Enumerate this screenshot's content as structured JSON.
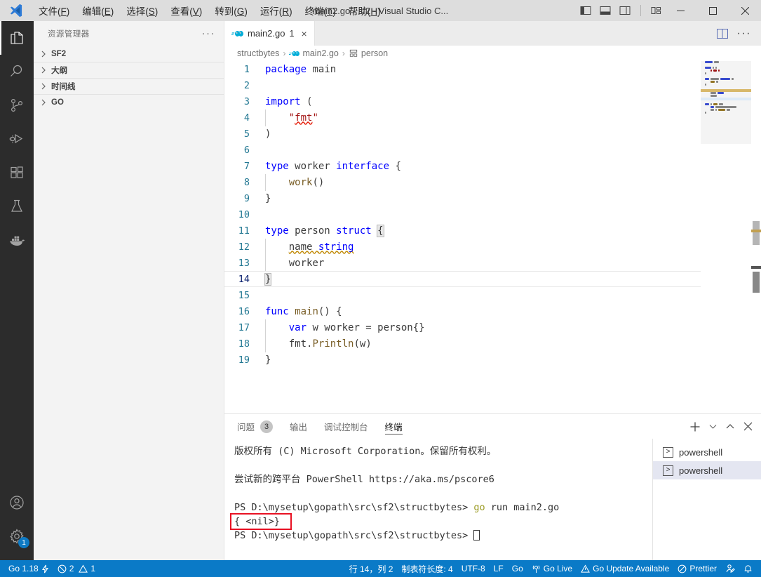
{
  "titlebar": {
    "logo_icon": "vscode-logo-icon",
    "window_title": "main2.go - sf2 - Visual Studio C...",
    "menus": [
      {
        "label": "文件(F)",
        "name": "menu-file"
      },
      {
        "label": "编辑(E)",
        "name": "menu-edit"
      },
      {
        "label": "选择(S)",
        "name": "menu-selection"
      },
      {
        "label": "查看(V)",
        "name": "menu-view"
      },
      {
        "label": "转到(G)",
        "name": "menu-go"
      },
      {
        "label": "运行(R)",
        "name": "menu-run"
      },
      {
        "label": "终端(T)",
        "name": "menu-terminal"
      },
      {
        "label": "帮助(H)",
        "name": "menu-help"
      }
    ],
    "layout_icons": [
      "toggle-primary-sidebar-icon",
      "toggle-panel-icon",
      "toggle-secondary-sidebar-icon",
      "customize-layout-icon"
    ],
    "window_controls": [
      "minimize-icon",
      "maximize-icon",
      "close-icon"
    ]
  },
  "activitybar": {
    "items": [
      {
        "label": "资源管理器",
        "icon": "files-explorer-icon",
        "active": true
      },
      {
        "label": "搜索",
        "icon": "search-icon",
        "active": false
      },
      {
        "label": "源代码管理",
        "icon": "source-control-icon",
        "active": false
      },
      {
        "label": "运行和调试",
        "icon": "run-and-debug-icon",
        "active": false
      },
      {
        "label": "扩展",
        "icon": "extensions-icon",
        "active": false
      },
      {
        "label": "测试",
        "icon": "testing-flask-icon",
        "active": false
      },
      {
        "label": "Docker",
        "icon": "docker-whale-icon",
        "active": false
      }
    ],
    "bottom": [
      {
        "label": "帐户",
        "icon": "account-icon",
        "badge": ""
      },
      {
        "label": "管理",
        "icon": "gear-icon",
        "badge": "1"
      }
    ]
  },
  "sidebar": {
    "title": "资源管理器",
    "more_actions": "···",
    "sections": [
      {
        "label": "SF2",
        "name": "sidebar-section-sf2"
      },
      {
        "label": "大纲",
        "name": "sidebar-section-outline"
      },
      {
        "label": "时间线",
        "name": "sidebar-section-timeline"
      },
      {
        "label": "GO",
        "name": "sidebar-section-go"
      }
    ]
  },
  "editor": {
    "tab": {
      "icon": "go-file-icon",
      "label": "main2.go",
      "badge": "1",
      "close": "×"
    },
    "actions": {
      "split_icon": "split-editor-icon",
      "more": "···"
    },
    "breadcrumb": [
      {
        "label": "structbytes",
        "icon": ""
      },
      {
        "label": "main2.go",
        "icon": "go-file-icon"
      },
      {
        "label": "person",
        "icon": "symbol-struct-icon"
      }
    ],
    "lines": [
      {
        "n": "1",
        "tokens": [
          {
            "t": "package",
            "c": "kw"
          },
          {
            "t": " main",
            "c": "pl"
          }
        ]
      },
      {
        "n": "2",
        "tokens": []
      },
      {
        "n": "3",
        "tokens": [
          {
            "t": "import",
            "c": "kw"
          },
          {
            "t": " ",
            "c": "pl"
          },
          {
            "t": "(",
            "c": "pl"
          }
        ]
      },
      {
        "n": "4",
        "tokens": [
          {
            "t": "\t",
            "c": "ind"
          },
          {
            "t": "\"",
            "c": "str"
          },
          {
            "t": "fmt",
            "c": "str sq-red"
          },
          {
            "t": "\"",
            "c": "str"
          }
        ]
      },
      {
        "n": "5",
        "tokens": [
          {
            "t": ")",
            "c": "pl"
          }
        ]
      },
      {
        "n": "6",
        "tokens": []
      },
      {
        "n": "7",
        "tokens": [
          {
            "t": "type",
            "c": "kw"
          },
          {
            "t": " worker ",
            "c": "pl"
          },
          {
            "t": "interface",
            "c": "kw"
          },
          {
            "t": " {",
            "c": "pl"
          }
        ]
      },
      {
        "n": "8",
        "tokens": [
          {
            "t": "\t",
            "c": "ind"
          },
          {
            "t": "work",
            "c": "fn"
          },
          {
            "t": "()",
            "c": "pl"
          }
        ]
      },
      {
        "n": "9",
        "tokens": [
          {
            "t": "}",
            "c": "pl"
          }
        ]
      },
      {
        "n": "10",
        "tokens": []
      },
      {
        "n": "11",
        "tokens": [
          {
            "t": "type",
            "c": "kw"
          },
          {
            "t": " person ",
            "c": "pl"
          },
          {
            "t": "struct",
            "c": "kw"
          },
          {
            "t": " ",
            "c": "pl"
          },
          {
            "t": "{",
            "c": "pl brk"
          }
        ]
      },
      {
        "n": "12",
        "tokens": [
          {
            "t": "\t",
            "c": "ind"
          },
          {
            "t": "name ",
            "c": "pl sq-yel"
          },
          {
            "t": "string",
            "c": "kw sq-yel"
          }
        ]
      },
      {
        "n": "13",
        "tokens": [
          {
            "t": "\t",
            "c": "ind"
          },
          {
            "t": "worker",
            "c": "pl"
          }
        ]
      },
      {
        "n": "14",
        "tokens": [
          {
            "t": "}",
            "c": "pl brk"
          }
        ],
        "current": true
      },
      {
        "n": "15",
        "tokens": []
      },
      {
        "n": "16",
        "tokens": [
          {
            "t": "func",
            "c": "kw"
          },
          {
            "t": " ",
            "c": "pl"
          },
          {
            "t": "main",
            "c": "fn"
          },
          {
            "t": "() {",
            "c": "pl"
          }
        ]
      },
      {
        "n": "17",
        "tokens": [
          {
            "t": "\t",
            "c": "ind"
          },
          {
            "t": "var",
            "c": "kw"
          },
          {
            "t": " w worker = person{}",
            "c": "pl"
          }
        ]
      },
      {
        "n": "18",
        "tokens": [
          {
            "t": "\t",
            "c": "ind"
          },
          {
            "t": "fmt",
            "c": "pl"
          },
          {
            "t": ".",
            "c": "pl"
          },
          {
            "t": "Println",
            "c": "fn"
          },
          {
            "t": "(w)",
            "c": "pl"
          }
        ]
      },
      {
        "n": "19",
        "tokens": [
          {
            "t": "}",
            "c": "pl"
          }
        ]
      }
    ]
  },
  "panel": {
    "tabs": [
      {
        "label": "问题",
        "badge": "3",
        "active": false,
        "name": "panel-tab-problems"
      },
      {
        "label": "输出",
        "badge": "",
        "active": false,
        "name": "panel-tab-output"
      },
      {
        "label": "调试控制台",
        "badge": "",
        "active": false,
        "name": "panel-tab-debug-console"
      },
      {
        "label": "终端",
        "badge": "",
        "active": true,
        "name": "panel-tab-terminal"
      }
    ],
    "actions": [
      {
        "icon": "add-terminal-icon",
        "glyph": "+"
      },
      {
        "icon": "chevron-down-icon",
        "glyph": "⌄"
      },
      {
        "icon": "maximize-panel-icon",
        "glyph": "⌃"
      },
      {
        "icon": "close-panel-icon",
        "glyph": "✕"
      }
    ],
    "terminal": {
      "rows": [
        {
          "text": "版权所有 (C) Microsoft Corporation。保留所有权利。",
          "kind": "plain"
        },
        {
          "text": "",
          "kind": "plain"
        },
        {
          "text": "尝试新的跨平台 PowerShell https://aka.ms/pscore6",
          "kind": "plain"
        },
        {
          "text": "",
          "kind": "plain"
        },
        {
          "prompt": "PS D:\\mysetup\\gopath\\src\\sf2\\structbytes> ",
          "cmd_prefix": "go",
          "cmd_rest": " run main2.go",
          "kind": "command"
        },
        {
          "text": "{ <nil>}",
          "kind": "highlighted-output"
        },
        {
          "prompt": "PS D:\\mysetup\\gopath\\src\\sf2\\structbytes> ",
          "kind": "prompt-cursor"
        }
      ],
      "annotation_color": "#e81123"
    },
    "terminal_tabs": [
      {
        "label": "powershell",
        "icon": "terminal-chevron-icon",
        "active": false
      },
      {
        "label": "powershell",
        "icon": "terminal-chevron-icon",
        "active": true
      }
    ]
  },
  "statusbar": {
    "background": "#0a7ac7",
    "left": [
      {
        "label": "Go 1.18",
        "icon": "lightning-icon",
        "name": "status-go-version"
      },
      {
        "label": "2",
        "icon": "error-icon",
        "label2": "1",
        "icon2": "warning-icon",
        "name": "status-problems"
      }
    ],
    "right": [
      {
        "label": "行 14，列 2",
        "icon": "",
        "name": "status-cursor-position"
      },
      {
        "label": "制表符长度: 4",
        "icon": "",
        "name": "status-tab-size"
      },
      {
        "label": "UTF-8",
        "icon": "",
        "name": "status-encoding"
      },
      {
        "label": "LF",
        "icon": "",
        "name": "status-eol"
      },
      {
        "label": "Go",
        "icon": "",
        "name": "status-language-mode"
      },
      {
        "label": "Go Live",
        "icon": "broadcast-icon",
        "name": "status-go-live"
      },
      {
        "label": "Go Update Available",
        "icon": "warning-icon",
        "name": "status-go-update"
      },
      {
        "label": "Prettier",
        "icon": "circle-slash-icon",
        "name": "status-prettier"
      },
      {
        "label": "",
        "icon": "feedback-person-icon",
        "name": "status-feedback"
      },
      {
        "label": "",
        "icon": "bell-icon",
        "name": "status-notifications"
      }
    ]
  }
}
